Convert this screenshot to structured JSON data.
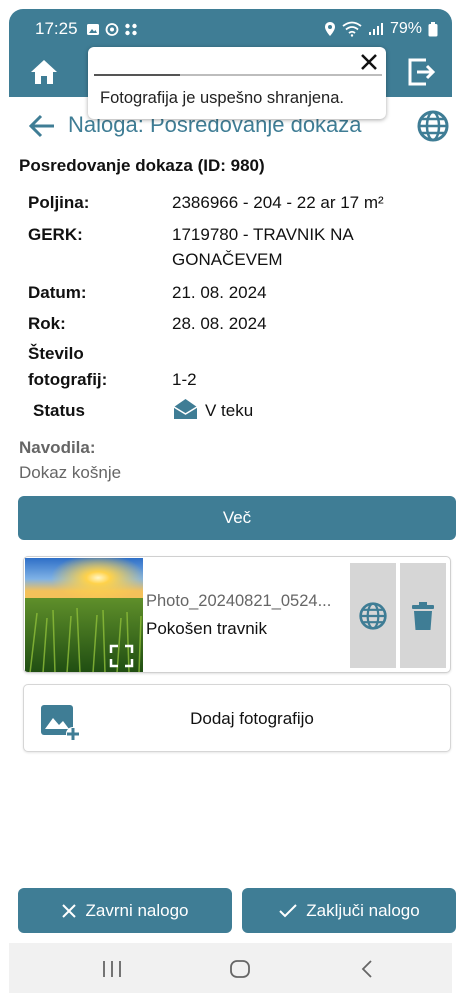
{
  "status_bar": {
    "time": "17:25",
    "battery": "79%"
  },
  "toast": {
    "message": "Fotografija je uspešno shranjena.",
    "progress": 0.3
  },
  "header": {
    "title": "Naloga: Posredovanje dokaza"
  },
  "task": {
    "section_title": "Posredovanje dokaza (ID: 980)",
    "fields": [
      {
        "label": "Poljina:",
        "value": "2386966 - 204 - 22 ar 17 m²"
      },
      {
        "label": "GERK:",
        "value_line1": "1719780 - TRAVNIK NA",
        "value_line2": "GONAČEVEM"
      },
      {
        "label": "Datum:",
        "value": "21. 08. 2024"
      },
      {
        "label": "Rok:",
        "value": "28. 08. 2024"
      },
      {
        "label_line1": "Število",
        "label_line2": "fotografij:",
        "value": "1-2"
      },
      {
        "label": "Status",
        "value": "V teku"
      }
    ],
    "instructions_label": "Navodila:",
    "instructions_text": "Dokaz košnje",
    "more_button": "Več"
  },
  "photos": [
    {
      "filename": "Photo_20240821_0524...",
      "description": "Pokošen travnik"
    }
  ],
  "add_photo_label": "Dodaj fotografijo",
  "actions": {
    "reject": "Zavrni nalogo",
    "complete": "Zaključi nalogo"
  },
  "colors": {
    "primary": "#3f7d95"
  }
}
